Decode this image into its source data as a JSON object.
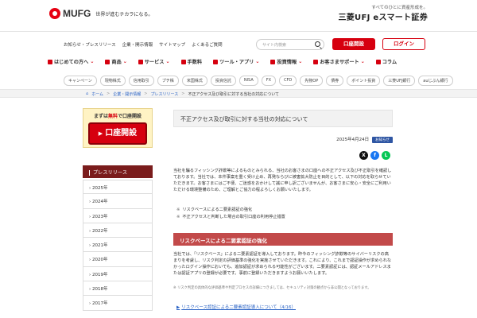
{
  "header": {
    "logo_text": "MUFG",
    "tagline": "世界が進むチカラになる。",
    "brand_small": "すべてのひとに資産形成を。",
    "brand_main": "三菱UFJ eスマート証券"
  },
  "subnav": {
    "links": [
      "お知らせ・プレスリリース",
      "企業・開示情報",
      "サイトマップ",
      "よくあるご質問"
    ],
    "search_placeholder": "サイト内検索",
    "open_account": "口座開設",
    "login": "ログイン"
  },
  "mainnav": {
    "items": [
      "はじめての方へ",
      "商品",
      "サービス",
      "手数料",
      "ツール・アプリ",
      "投資情報",
      "お客さまサポート",
      "コラム"
    ]
  },
  "tags": [
    "キャンペーン",
    "現物株式",
    "信用取引",
    "プチ株",
    "米国株式",
    "投資信託",
    "NISA",
    "FX",
    "CFD",
    "先物OP",
    "債券",
    "ポイント投資",
    "三菱UFJ銀行",
    "auじぶん銀行"
  ],
  "breadcrumb": [
    "ホーム",
    "企業・開示情報",
    "プレスリリース",
    "不正アクセス及び取引に対する当社の対応について"
  ],
  "promo": {
    "label_pre": "まずは",
    "label_red": "無料",
    "label_post": "で口座開設",
    "button": "口座開設"
  },
  "sidebar": {
    "heading": "プレスリリース",
    "years": [
      "2025年",
      "2024年",
      "2023年",
      "2022年",
      "2021年",
      "2020年",
      "2019年",
      "2018年",
      "2017年"
    ]
  },
  "article": {
    "title": "不正アクセス及び取引に対する当社の対応について",
    "date": "2025年4月24日",
    "badge": "お知らせ",
    "para1": "当社を騙るフィッシング詐欺等によるものとみられる、当社のお客さまの口座への不正アクセス及び不正取引を確認しております。当社では、本件事案を重く受け止め、再発ならびに被害拡大防止を目的として、以下の対応を取らせていただきます。お客さまにはご不便、ご迷惑をおかけして誠に申し訳ございませんが、お客さまに安心・安全にご利用いただける環境整備のため、ご理解とご協力の程よろしくお願いいたします。",
    "bullet1": "リスクベースによる二要素認証の強化",
    "bullet2": "不正アクセスと判断した場合の取引口座の利用停止措置",
    "section_heading": "リスクベースによる二要素認証の強化",
    "para2": "当社では、「リスクベース」による二要素認証を導入しております。昨今のフィッシング詐欺等のサイバーリスクの高まりを考慮し、リスク判定の評価基準の強化を実施させていただきます。これにより、これまで認証操作が求められなかったログイン操作においても、追加認証が求められる可能性がございます。二要素認証には、認証メールアドレスまたは認証アプリの登録が必要です。事前に登録いただきますようお願いいたします。",
    "note": "※ リスク判定の具体的な評価基準や判定プロセスの詳細につきましては、セキュリティ対策の観点から非公開となっております。",
    "link": "リスクベース認証による二要素認証導入について（4/16）"
  }
}
